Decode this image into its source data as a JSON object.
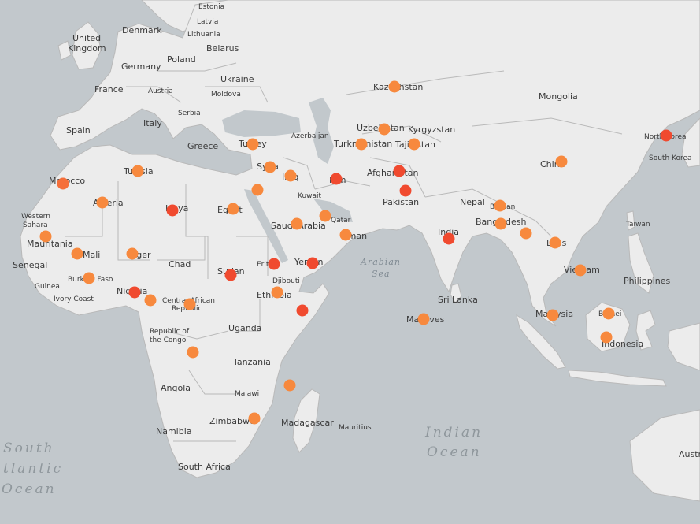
{
  "colors": {
    "water": "#c2c8cc",
    "land": "#ececec",
    "border": "#b9b9b9",
    "marker_high": "#f04a2f",
    "marker_mid": "#f56f3a",
    "marker_low": "#f7893e"
  },
  "oceans": [
    {
      "id": "south-atlantic-1",
      "text": "South"
    },
    {
      "id": "south-atlantic-2",
      "text": "tlantic"
    },
    {
      "id": "south-atlantic-3",
      "text": "Ocean"
    },
    {
      "id": "indian-1",
      "text": "Indian"
    },
    {
      "id": "indian-2",
      "text": "Ocean"
    },
    {
      "id": "arabian-1",
      "text": "Arabian"
    },
    {
      "id": "arabian-2",
      "text": "Sea"
    }
  ],
  "labels": [
    "Estonia",
    "Latvia",
    "Lithuania",
    "Denmark",
    "United",
    "Kingdom",
    "Belarus",
    "Poland",
    "Germany",
    "Ukraine",
    "Austria",
    "Moldova",
    "France",
    "Serbia",
    "Italy",
    "Spain",
    "Greece",
    "Azerbaijan",
    "Turkey",
    "Kazakhstan",
    "Mongolia",
    "Uzbekistan",
    "Kyrgyzstan",
    "Turkmenistan",
    "Tajikistan",
    "North Korea",
    "South Korea",
    "China",
    "Tunisia",
    "Morocco",
    "Syria",
    "Iraq",
    "Kuwait",
    "Iran",
    "Afghanistan",
    "Pakistan",
    "Algeria",
    "Libya",
    "Egypt",
    "Saudi Arabia",
    "Nepal",
    "Bhutan",
    "Western",
    "Sahara",
    "Qatar",
    "Oman",
    "India",
    "Bangladesh",
    "Taiwan",
    "Mauritania",
    "Mali",
    "Niger",
    "Chad",
    "Sudan",
    "Eritrea",
    "Yemen",
    "Laos",
    "Vietnam",
    "Senegal",
    "Burkina Faso",
    "Guinea",
    "Ivory Coast",
    "Djibouti",
    "Philippines",
    "Nigeria",
    "Central African",
    "Republic",
    "Ethiopia",
    "Sri Lanka",
    "Malaysia",
    "Brunei",
    "Maldives",
    "Republic of",
    "the Congo",
    "Uganda",
    "Indonesia",
    "Tanzania",
    "Angola",
    "Malawi",
    "Zimbabwe",
    "Namibia",
    "Madagascar",
    "Mauritius",
    "South Africa",
    "Austr"
  ],
  "markers": [
    {
      "country": "Morocco",
      "level": "mid"
    },
    {
      "country": "Tunisia",
      "level": "low"
    },
    {
      "country": "Algeria",
      "level": "low"
    },
    {
      "country": "Libya",
      "level": "high"
    },
    {
      "country": "Western Sahara",
      "level": "low"
    },
    {
      "country": "Mali",
      "level": "low"
    },
    {
      "country": "Niger",
      "level": "low"
    },
    {
      "country": "Burkina Faso",
      "level": "low"
    },
    {
      "country": "Nigeria",
      "level": "high"
    },
    {
      "country": "Cameroon",
      "level": "low"
    },
    {
      "country": "Central African Republic",
      "level": "low"
    },
    {
      "country": "Democratic Republic of the Congo",
      "level": "low"
    },
    {
      "country": "Egypt",
      "level": "low"
    },
    {
      "country": "Sudan",
      "level": "high"
    },
    {
      "country": "Eritrea",
      "level": "high"
    },
    {
      "country": "Ethiopia",
      "level": "low"
    },
    {
      "country": "Somalia",
      "level": "high"
    },
    {
      "country": "Mozambique",
      "level": "low"
    },
    {
      "country": "Zimbabwe",
      "level": "low"
    },
    {
      "country": "Turkey",
      "level": "low"
    },
    {
      "country": "Syria",
      "level": "low"
    },
    {
      "country": "Lebanon",
      "level": "low"
    },
    {
      "country": "Iraq",
      "level": "low"
    },
    {
      "country": "Iran",
      "level": "high"
    },
    {
      "country": "Saudi Arabia",
      "level": "low"
    },
    {
      "country": "Bahrain",
      "level": "low"
    },
    {
      "country": "Oman",
      "level": "low"
    },
    {
      "country": "Yemen",
      "level": "high"
    },
    {
      "country": "Kazakhstan",
      "level": "low"
    },
    {
      "country": "Uzbekistan",
      "level": "low"
    },
    {
      "country": "Turkmenistan",
      "level": "low"
    },
    {
      "country": "Tajikistan",
      "level": "low"
    },
    {
      "country": "Afghanistan",
      "level": "high"
    },
    {
      "country": "Pakistan",
      "level": "high"
    },
    {
      "country": "India",
      "level": "high"
    },
    {
      "country": "Bhutan",
      "level": "low"
    },
    {
      "country": "Bangladesh",
      "level": "low"
    },
    {
      "country": "Myanmar",
      "level": "low"
    },
    {
      "country": "Laos",
      "level": "low"
    },
    {
      "country": "Vietnam",
      "level": "low"
    },
    {
      "country": "Maldives",
      "level": "low"
    },
    {
      "country": "Malaysia",
      "level": "low"
    },
    {
      "country": "Brunei",
      "level": "low"
    },
    {
      "country": "Indonesia",
      "level": "low"
    },
    {
      "country": "China",
      "level": "low"
    },
    {
      "country": "North Korea",
      "level": "high"
    }
  ]
}
